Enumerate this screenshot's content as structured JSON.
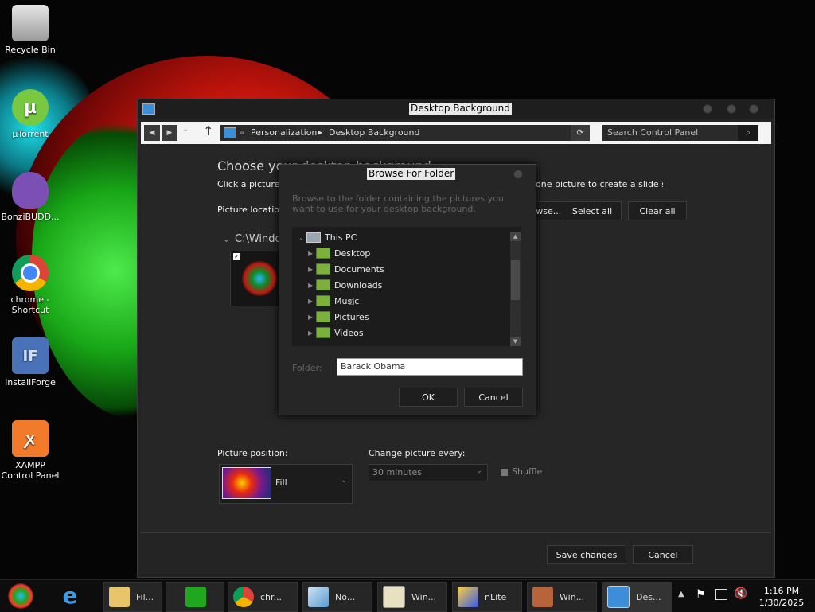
{
  "desktop": {
    "icons": [
      {
        "label": "Recycle Bin",
        "icon": "recycle-bin-icon",
        "color": "#c8c8c8"
      },
      {
        "label": "µTorrent",
        "icon": "utorrent-icon",
        "color": "#78c841"
      },
      {
        "label": "BonziBUDD...",
        "icon": "bonzibuddy-icon",
        "color": "#7b4fb3"
      },
      {
        "label": "chrome - Shortcut",
        "icon": "chrome-icon",
        "color": "#db4437"
      },
      {
        "label": "InstallForge",
        "icon": "installforge-icon",
        "color": "#4a72b8"
      },
      {
        "label": "XAMPP Control Panel",
        "icon": "xampp-icon",
        "color": "#f27b2b"
      }
    ]
  },
  "window": {
    "title": "Desktop Background",
    "breadcrumb": {
      "prefix": "«",
      "crumbs": [
        "Personalization",
        "Desktop Background"
      ]
    },
    "search_placeholder": "Search Control Panel",
    "heading": "Choose your desktop background",
    "instructions": "Click a picture to make it your desktop background, or select more than one picture to create a slide show.",
    "picture_location_label": "Picture location:",
    "browse_label": "Browse...",
    "select_all_label": "Select all",
    "clear_all_label": "Clear all",
    "folder_group": "C:\\Windows\\Web\\Wallpaper",
    "picture_position_label": "Picture position:",
    "picture_position_value": "Fill",
    "change_picture_label": "Change picture every:",
    "change_picture_value": "30 minutes",
    "shuffle_label": "Shuffle",
    "save_label": "Save changes",
    "cancel_label": "Cancel"
  },
  "dialog": {
    "title": "Browse For Folder",
    "description": "Browse to the folder containing the pictures you want to use for your desktop background.",
    "tree_root": "This PC",
    "tree_items": [
      "Desktop",
      "Documents",
      "Downloads",
      "Music",
      "Pictures",
      "Videos"
    ],
    "folder_label": "Folder:",
    "folder_value": "Barack Obama",
    "ok_label": "OK",
    "cancel_label": "Cancel"
  },
  "taskbar": {
    "items": [
      {
        "label": "Fil...",
        "icon": "file-explorer-icon"
      },
      {
        "label": "",
        "icon": "store-icon"
      },
      {
        "label": "chr...",
        "icon": "chrome-icon"
      },
      {
        "label": "No...",
        "icon": "notepad-icon"
      },
      {
        "label": "Win...",
        "icon": "winrar-icon"
      },
      {
        "label": "nLite",
        "icon": "nlite-icon"
      },
      {
        "label": "Win...",
        "icon": "windows-icon"
      },
      {
        "label": "Des...",
        "icon": "desktop-background-icon"
      }
    ],
    "time": "1:16 PM",
    "date": "1/30/2025"
  }
}
